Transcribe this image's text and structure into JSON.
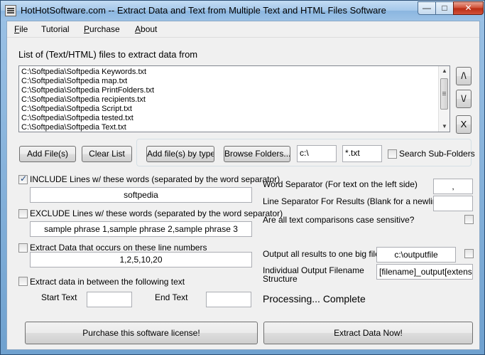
{
  "window": {
    "title": "HotHotSoftware.com -- Extract Data and Text from Multiple Text and HTML Files Software",
    "minimize_glyph": "—",
    "maximize_glyph": "□",
    "close_glyph": "✕",
    "icon": "document-lines-icon"
  },
  "menu": {
    "file": {
      "underlined": "F",
      "rest": "ile"
    },
    "tutorial": "Tutorial",
    "purchase": {
      "underlined": "P",
      "rest": "urchase"
    },
    "about": {
      "underlined": "A",
      "rest": "bout"
    }
  },
  "file_list": {
    "heading": "List of (Text/HTML) files to extract data from",
    "items": [
      "C:\\Softpedia\\Softpedia Keywords.txt",
      "C:\\Softpedia\\Softpedia map.txt",
      "C:\\Softpedia\\Softpedia PrintFolders.txt",
      "C:\\Softpedia\\Softpedia recipients.txt",
      "C:\\Softpedia\\Softpedia Script.txt",
      "C:\\Softpedia\\Softpedia tested.txt",
      "C:\\Softpedia\\Softpedia Text.txt"
    ],
    "move_up_glyph": "/\\",
    "move_down_glyph": "\\/",
    "remove_glyph": "X"
  },
  "file_buttons": {
    "add_files": "Add File(s)",
    "clear_list": "Clear List",
    "add_by_type": "Add file(s) by type",
    "browse_folders": "Browse Folders...",
    "folder_value": "c:\\",
    "type_value": "*.txt",
    "search_subfolders": "Search Sub-Folders"
  },
  "include": {
    "label": "INCLUDE Lines w/ these words (separated by the word separator)",
    "checked": true,
    "value": "softpedia"
  },
  "exclude": {
    "label": "EXCLUDE Lines w/ these words (separated by the word separator)",
    "checked": false,
    "value": "sample phrase 1,sample phrase 2,sample phrase 3"
  },
  "line_numbers": {
    "label": "Extract Data that occurs on these line numbers",
    "checked": false,
    "value": "1,2,5,10,20"
  },
  "between": {
    "label": "Extract data in between the following text",
    "checked": false,
    "start_label": "Start Text",
    "start_value": "",
    "end_label": "End Text",
    "end_value": ""
  },
  "options": {
    "word_separator_label": "Word Separator (For text on the left side)",
    "word_separator_value": ",",
    "line_separator_label": "Line Separator For Results (Blank for a newline)",
    "line_separator_value": "",
    "case_sensitive_label": "Are all text comparisons case sensitive?",
    "case_sensitive_checked": false,
    "one_file_label": "Output all results to one big file?",
    "one_file_value": "c:\\outputfile",
    "one_file_checked": false,
    "filename_structure_label_1": "Individual Output Filename",
    "filename_structure_label_2": "Structure",
    "filename_structure_value": "[filename]_output[extension]"
  },
  "status": "Processing... Complete",
  "actions": {
    "purchase": "Purchase this software license!",
    "extract": "Extract Data Now!"
  }
}
